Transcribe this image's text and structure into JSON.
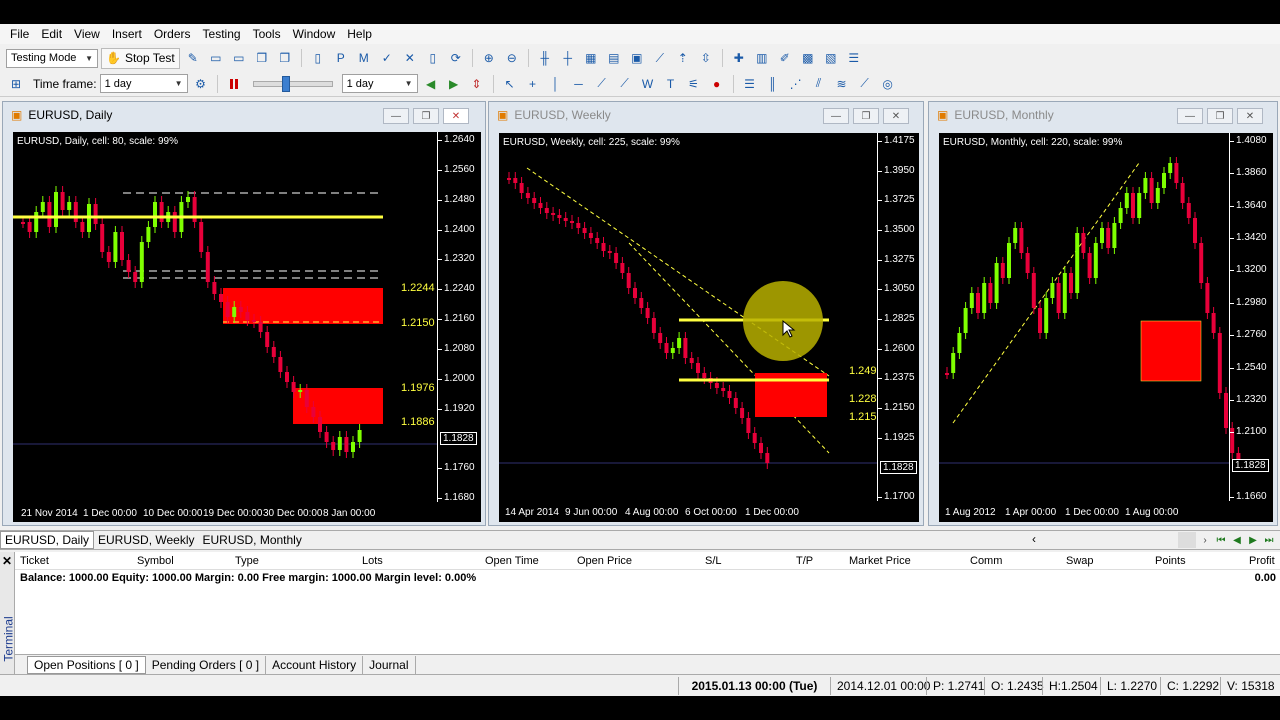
{
  "menu": [
    "File",
    "Edit",
    "View",
    "Insert",
    "Orders",
    "Testing",
    "Tools",
    "Window",
    "Help"
  ],
  "toolbar": {
    "mode_select": "Testing Mode",
    "stop_test": "Stop Test",
    "timeframe_label": "Time frame:",
    "timeframe_value": "1 day",
    "speed_value": "1 day"
  },
  "charts": {
    "daily": {
      "title": "EURUSD, Daily",
      "info": "EURUSD, Daily, cell: 80, scale: 99%",
      "price_ticks": [
        "1.2640",
        "1.2560",
        "1.2480",
        "1.2400",
        "1.2320",
        "1.2240",
        "1.2160",
        "1.2080",
        "1.2000",
        "1.1920",
        "1.1828",
        "1.1760",
        "1.1680"
      ],
      "current_price": "1.1828",
      "time_labels": [
        "21 Nov 2014",
        "1 Dec 00:00",
        "10 Dec 00:00",
        "19 Dec 00:00",
        "30 Dec 00:00",
        "8 Jan 00:00"
      ],
      "levels": [
        "1.2244",
        "1.2150",
        "1.1976",
        "1.1886"
      ]
    },
    "weekly": {
      "title": "EURUSD, Weekly",
      "info": "EURUSD, Weekly, cell: 225, scale: 99%",
      "price_ticks": [
        "1.4175",
        "1.3950",
        "1.3725",
        "1.3500",
        "1.3275",
        "1.3050",
        "1.2825",
        "1.2600",
        "1.2375",
        "1.2150",
        "1.1925",
        "1.1828",
        "1.1700"
      ],
      "current_price": "1.1828",
      "time_labels": [
        "14 Apr 2014",
        "9 Jun 00:00",
        "4 Aug 00:00",
        "6 Oct 00:00",
        "1 Dec 00:00"
      ],
      "levels": [
        "1.249",
        "1.228",
        "1.215"
      ]
    },
    "monthly": {
      "title": "EURUSD, Monthly",
      "info": "EURUSD, Monthly, cell: 220, scale: 99%",
      "price_ticks": [
        "1.4080",
        "1.3860",
        "1.3640",
        "1.3420",
        "1.3200",
        "1.2980",
        "1.2760",
        "1.2540",
        "1.2320",
        "1.2100",
        "1.1828",
        "1.1660"
      ],
      "current_price": "1.1828",
      "time_labels": [
        "1 Aug 2012",
        "1 Apr 00:00",
        "1 Dec 00:00",
        "1 Aug 00:00"
      ]
    }
  },
  "chart_tabs": [
    "EURUSD, Daily",
    "EURUSD, Weekly",
    "EURUSD, Monthly"
  ],
  "terminal": {
    "side_title": "Terminal",
    "columns": [
      "Ticket",
      "Symbol",
      "Type",
      "Lots",
      "Open Time",
      "Open Price",
      "S/L",
      "T/P",
      "Market Price",
      "Comm",
      "Swap",
      "Points",
      "Profit"
    ],
    "balance_line": "Balance: 1000.00 Equity: 1000.00 Margin: 0.00 Free margin: 1000.00 Margin level: 0.00%",
    "profit_total": "0.00",
    "tabs": [
      "Open Positions  [ 0 ]",
      "Pending Orders  [ 0 ]",
      "Account History",
      "Journal"
    ]
  },
  "status": {
    "datetime": "2015.01.13 00:00 (Tue)",
    "bar_time": "2014.12.01 00:00",
    "price": "P: 1.2741",
    "open": "O: 1.2435",
    "high": "H:1.2504",
    "low": "L: 1.2270",
    "close": "C: 1.2292",
    "volume": "V: 15318"
  },
  "colors": {
    "bull": "#7fff00",
    "bear": "#e8003a",
    "zone": "#ff0000",
    "level": "#ffff40"
  }
}
